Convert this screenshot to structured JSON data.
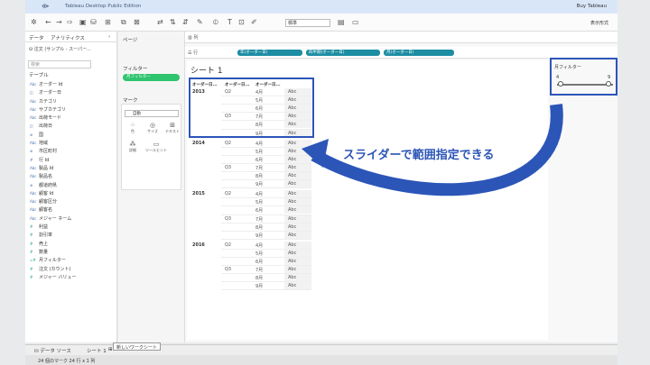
{
  "app": {
    "title": "Tableau Desktop Public Edition",
    "buy": "Buy Tableau",
    "show_me": "表示形式",
    "toolbar_select": "標準"
  },
  "side": {
    "tabs": [
      "データ",
      "アナリティクス"
    ],
    "datasource": "注文 (サンプル - スーパー...",
    "search_placeholder": "検索",
    "section_table": "テーブル",
    "fields": [
      {
        "type": "Abc",
        "name": "オーダー Id",
        "kind": "dim"
      },
      {
        "type": "◫",
        "name": "オーダー日",
        "kind": "dim"
      },
      {
        "type": "Abc",
        "name": "カテゴリ",
        "kind": "dim"
      },
      {
        "type": "Abc",
        "name": "サブカテゴリ",
        "kind": "dim"
      },
      {
        "type": "Abc",
        "name": "出荷モード",
        "kind": "dim"
      },
      {
        "type": "◫",
        "name": "出荷日",
        "kind": "dim"
      },
      {
        "type": "⊕",
        "name": "国",
        "kind": "dim"
      },
      {
        "type": "Abc",
        "name": "地域",
        "kind": "dim"
      },
      {
        "type": "⊕",
        "name": "市区町村",
        "kind": "dim"
      },
      {
        "type": "#",
        "name": "行 Id",
        "kind": "dim"
      },
      {
        "type": "Abc",
        "name": "製品 Id",
        "kind": "dim"
      },
      {
        "type": "Abc",
        "name": "製品名",
        "kind": "dim"
      },
      {
        "type": "⊕",
        "name": "都道府県",
        "kind": "dim"
      },
      {
        "type": "Abc",
        "name": "顧客 Id",
        "kind": "dim"
      },
      {
        "type": "Abc",
        "name": "顧客区分",
        "kind": "dim"
      },
      {
        "type": "Abc",
        "name": "顧客名",
        "kind": "dim"
      },
      {
        "type": "Abc",
        "name": "メジャー ネーム",
        "kind": "dim"
      },
      {
        "type": "#",
        "name": "利益",
        "kind": "meas"
      },
      {
        "type": "#",
        "name": "割引率",
        "kind": "meas"
      },
      {
        "type": "#",
        "name": "売上",
        "kind": "meas"
      },
      {
        "type": "#",
        "name": "数量",
        "kind": "meas"
      },
      {
        "type": "=#",
        "name": "月フィルター",
        "kind": "meas"
      },
      {
        "type": "#",
        "name": "注文 (カウント)",
        "kind": "meas"
      },
      {
        "type": "#",
        "name": "メジャー バリュー",
        "kind": "meas"
      }
    ]
  },
  "cards": {
    "pages": "ページ",
    "filters": "フィルター",
    "filter_pill": "月フィルター",
    "marks": "マーク",
    "marks_type": "自動",
    "mark_buttons": [
      "色",
      "サイズ",
      "テキスト",
      "詳細",
      "ツールヒント"
    ]
  },
  "shelves": {
    "columns": "列",
    "rows": "行",
    "row_pills": [
      "年(オーダー日)",
      "四半期(オーダー日)",
      "月(オーダー日)"
    ]
  },
  "sheet": {
    "title": "シート 1",
    "headers": [
      "オーダー日...",
      "オーダー日...",
      "オーダー日..."
    ],
    "years": [
      {
        "year": "2013",
        "quarters": [
          {
            "q": "Q2",
            "months": [
              "4月",
              "5月",
              "6月"
            ]
          },
          {
            "q": "Q3",
            "months": [
              "7月",
              "8月",
              "9月"
            ]
          }
        ]
      },
      {
        "year": "2014",
        "quarters": [
          {
            "q": "Q2",
            "months": [
              "4月",
              "5月",
              "6月"
            ]
          },
          {
            "q": "Q3",
            "months": [
              "7月",
              "8月",
              "9月"
            ]
          }
        ]
      },
      {
        "year": "2015",
        "quarters": [
          {
            "q": "Q2",
            "months": [
              "4月",
              "5月",
              "6月"
            ]
          },
          {
            "q": "Q3",
            "months": [
              "7月",
              "8月",
              "9月"
            ]
          }
        ]
      },
      {
        "year": "2016",
        "quarters": [
          {
            "q": "Q2",
            "months": [
              "4月",
              "5月",
              "6月"
            ]
          },
          {
            "q": "Q3",
            "months": [
              "7月",
              "8月",
              "9月"
            ]
          }
        ]
      }
    ],
    "cell_value": "Abc"
  },
  "filter_card": {
    "title": "月フィルター",
    "min": "4",
    "max": "9",
    "low": 4,
    "high": 9
  },
  "annotation": {
    "text": "スライダーで範囲指定できる",
    "color": "#2c55b8"
  },
  "bottom": {
    "datasource_tab": "データ ソース",
    "sheet_tab": "シート 1",
    "tooltip": "新しいワークシート",
    "status": "24 個のマーク  24 行 x 1 列"
  }
}
